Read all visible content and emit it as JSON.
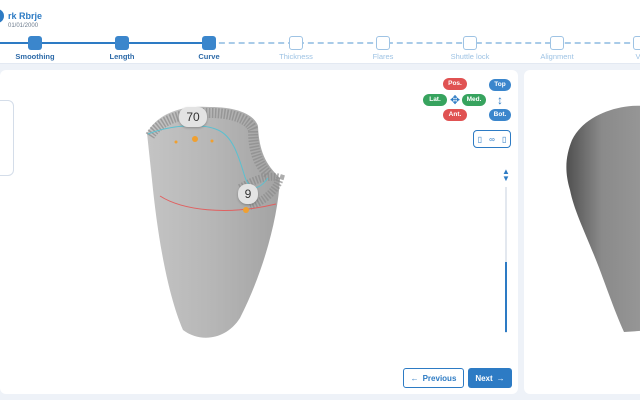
{
  "patient": {
    "name": "rk Rbrje",
    "date": "01/01/2000"
  },
  "steps": [
    {
      "label": "Smoothing",
      "state": "done"
    },
    {
      "label": "Length",
      "state": "done"
    },
    {
      "label": "Curve",
      "state": "done"
    },
    {
      "label": "Thickness",
      "state": "todo"
    },
    {
      "label": "Flares",
      "state": "todo"
    },
    {
      "label": "Shuttle lock",
      "state": "todo"
    },
    {
      "label": "Alignment",
      "state": "todo"
    },
    {
      "label": "V",
      "state": "todo"
    }
  ],
  "orientation": {
    "pos": "Pos.",
    "lat": "Lat.",
    "med": "Med.",
    "ant": "Ant.",
    "top": "Top",
    "bot": "Bot."
  },
  "measurements": {
    "upper": "70",
    "lower": "9"
  },
  "nav": {
    "previous": "Previous",
    "next": "Next"
  },
  "colors": {
    "accent": "#2d7bc4",
    "red": "#e05252",
    "green": "#37a35e",
    "curve_line": "#e06060",
    "trim_line": "#5bc0d0"
  },
  "icons": {
    "move": "move-arrows-icon",
    "vertical": "vertical-arrows-icon",
    "link": "link-icon",
    "scroll": "scroll-up-down-icon"
  }
}
